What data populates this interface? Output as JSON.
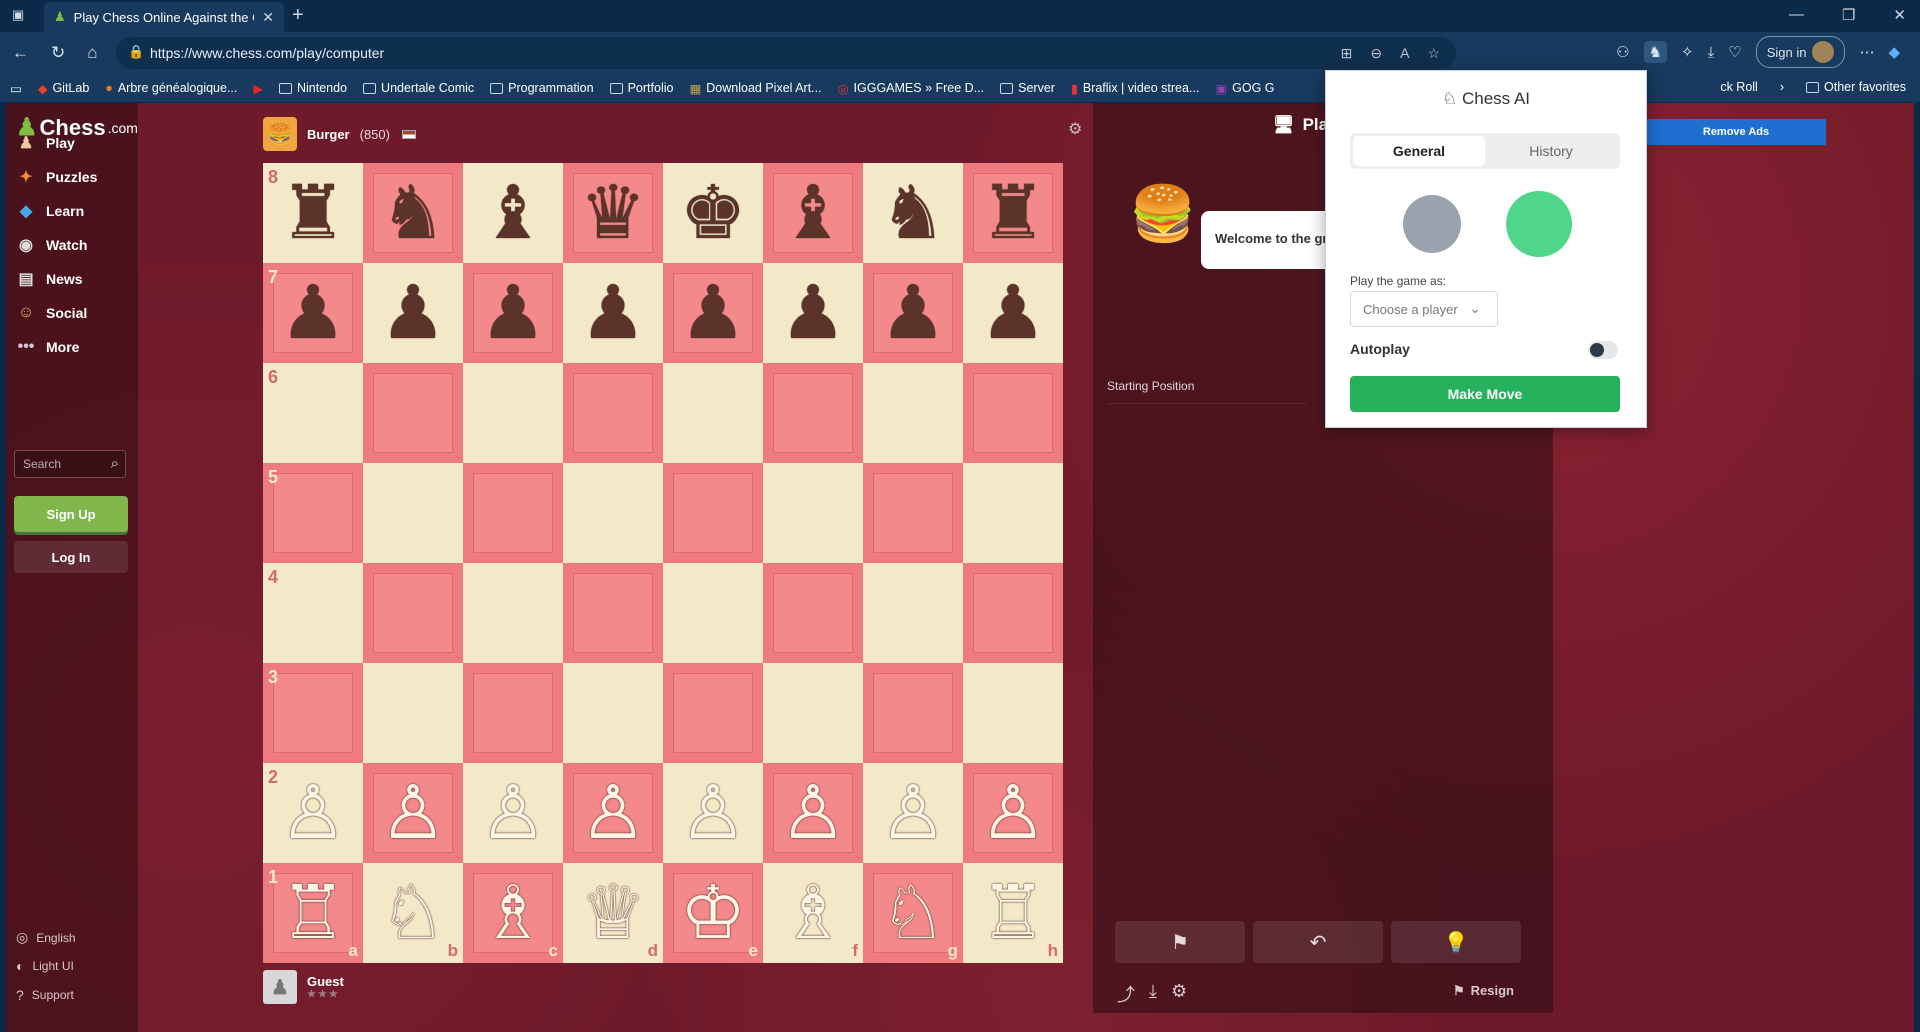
{
  "browser": {
    "tab_title": "Play Chess Online Against the Co",
    "url": "https://www.chess.com/play/computer",
    "signin_label": "Sign in",
    "bookmarks": [
      "GitLab",
      "Arbre généalogique...",
      "Nintendo",
      "Undertale Comic",
      "Programmation",
      "Portfolio",
      "Download Pixel Art...",
      "IGGGAMES » Free D...",
      "Server",
      "Braflix | video strea...",
      "GOG G"
    ],
    "bookmarks_right": [
      "ck Roll",
      "Other favorites"
    ]
  },
  "sidebar": {
    "logo_text": "Chess",
    "logo_suffix": ".com",
    "items": [
      "Play",
      "Puzzles",
      "Learn",
      "Watch",
      "News",
      "Social",
      "More"
    ],
    "search_placeholder": "Search",
    "signup_label": "Sign Up",
    "login_label": "Log In",
    "footer": [
      "English",
      "Light UI",
      "Support"
    ]
  },
  "game": {
    "opponent_name": "Burger",
    "opponent_rating": "(850)",
    "player_name": "Guest",
    "board": [
      [
        "♜",
        "♞",
        "♝",
        "♛",
        "♚",
        "♝",
        "♞",
        "♜"
      ],
      [
        "♟",
        "♟",
        "♟",
        "♟",
        "♟",
        "♟",
        "♟",
        "♟"
      ],
      [
        "",
        "",
        "",
        "",
        "",
        "",
        "",
        ""
      ],
      [
        "",
        "",
        "",
        "",
        "",
        "",
        "",
        ""
      ],
      [
        "",
        "",
        "",
        "",
        "",
        "",
        "",
        ""
      ],
      [
        "",
        "",
        "",
        "",
        "",
        "",
        "",
        ""
      ],
      [
        "♙",
        "♙",
        "♙",
        "♙",
        "♙",
        "♙",
        "♙",
        "♙"
      ],
      [
        "♖",
        "♘",
        "♗",
        "♕",
        "♔",
        "♗",
        "♘",
        "♖"
      ]
    ],
    "ranks": [
      "8",
      "7",
      "6",
      "5",
      "4",
      "3",
      "2",
      "1"
    ],
    "files": [
      "a",
      "b",
      "c",
      "d",
      "e",
      "f",
      "g",
      "h"
    ]
  },
  "panel": {
    "title": "Play",
    "welcome": "Welcome to the gr",
    "starting_position": "Starting Position",
    "resign_label": "Resign",
    "remove_ads": "Remove Ads"
  },
  "popup": {
    "title": "Chess AI",
    "tabs": [
      "General",
      "History"
    ],
    "play_as_label": "Play the game as:",
    "select_placeholder": "Choose a player",
    "autoplay_label": "Autoplay",
    "autoplay_on": false,
    "make_move_label": "Make Move",
    "colors": {
      "gray": "#9aa3ad",
      "green": "#4fd68a"
    }
  }
}
